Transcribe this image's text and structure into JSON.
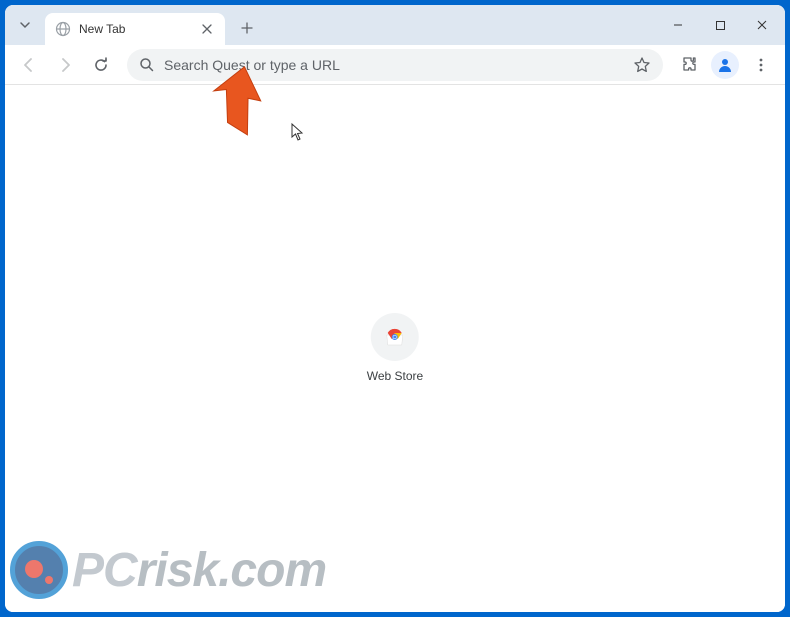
{
  "titlebar": {
    "tab_title": "New Tab"
  },
  "toolbar": {
    "omnibox_placeholder": "Search Quest or type a URL"
  },
  "content": {
    "shortcut_label": "Web Store"
  },
  "watermark": {
    "pc": "PC",
    "risk": "risk",
    "com": ".com"
  }
}
